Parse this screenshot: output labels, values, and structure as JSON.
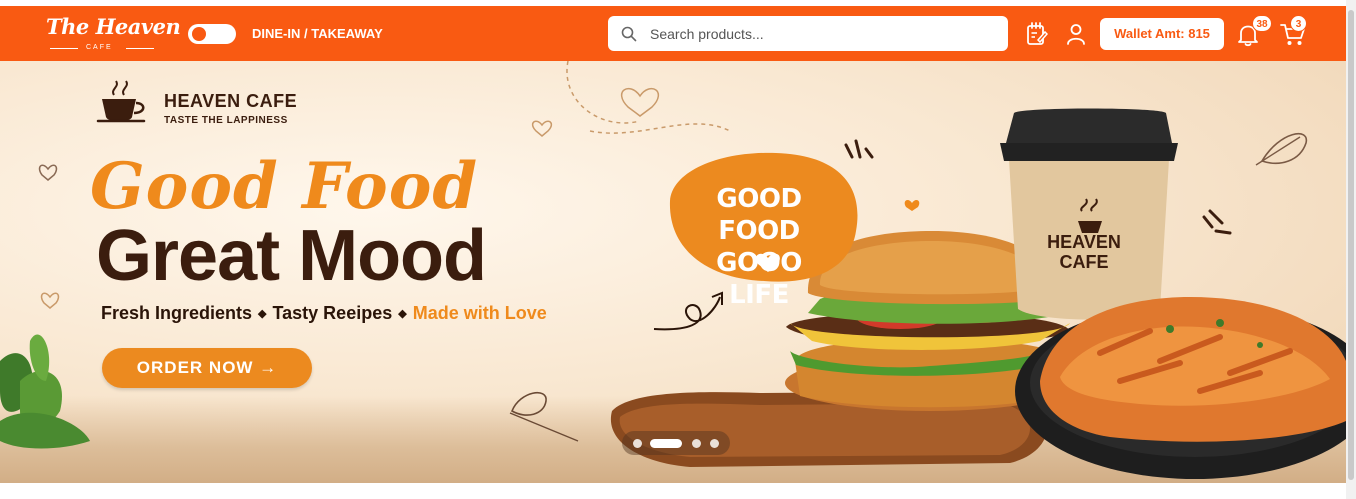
{
  "header": {
    "logo": {
      "script": "The Heaven",
      "sub": "CAFE"
    },
    "mode_label": "DINE-IN / TAKEAWAY",
    "search": {
      "placeholder": "Search products..."
    },
    "wallet_label": "Wallet Amt: 815",
    "notification_count": "38",
    "cart_count": "3"
  },
  "hero": {
    "brand_name": "HEAVEN CAFE",
    "brand_tagline": "TASTE THE LAPPINESS",
    "headline_1": "Good Food",
    "headline_2": "Great Mood",
    "tagline_parts": [
      "Fresh Ingredients",
      "Tasty Reeipes",
      "Made with Love"
    ],
    "tagline_separator": "◆",
    "cta_label": "ORDER NOW →",
    "badge_line_1": "GOOD FOOD",
    "badge_line_2": "GOOO LIFE",
    "cup_line_1": "HEAVEN",
    "cup_line_2": "CAFE"
  },
  "carousel": {
    "slide_count": 5,
    "active_index": 1
  },
  "colors": {
    "brand_orange": "#f95a12",
    "accent_orange": "#ef8a1c",
    "dark_brown": "#3b1d0e"
  },
  "icons": [
    "notes-icon",
    "user-icon",
    "bell-icon",
    "cart-icon",
    "search-icon",
    "coffee-cup-icon",
    "heart-icon"
  ]
}
